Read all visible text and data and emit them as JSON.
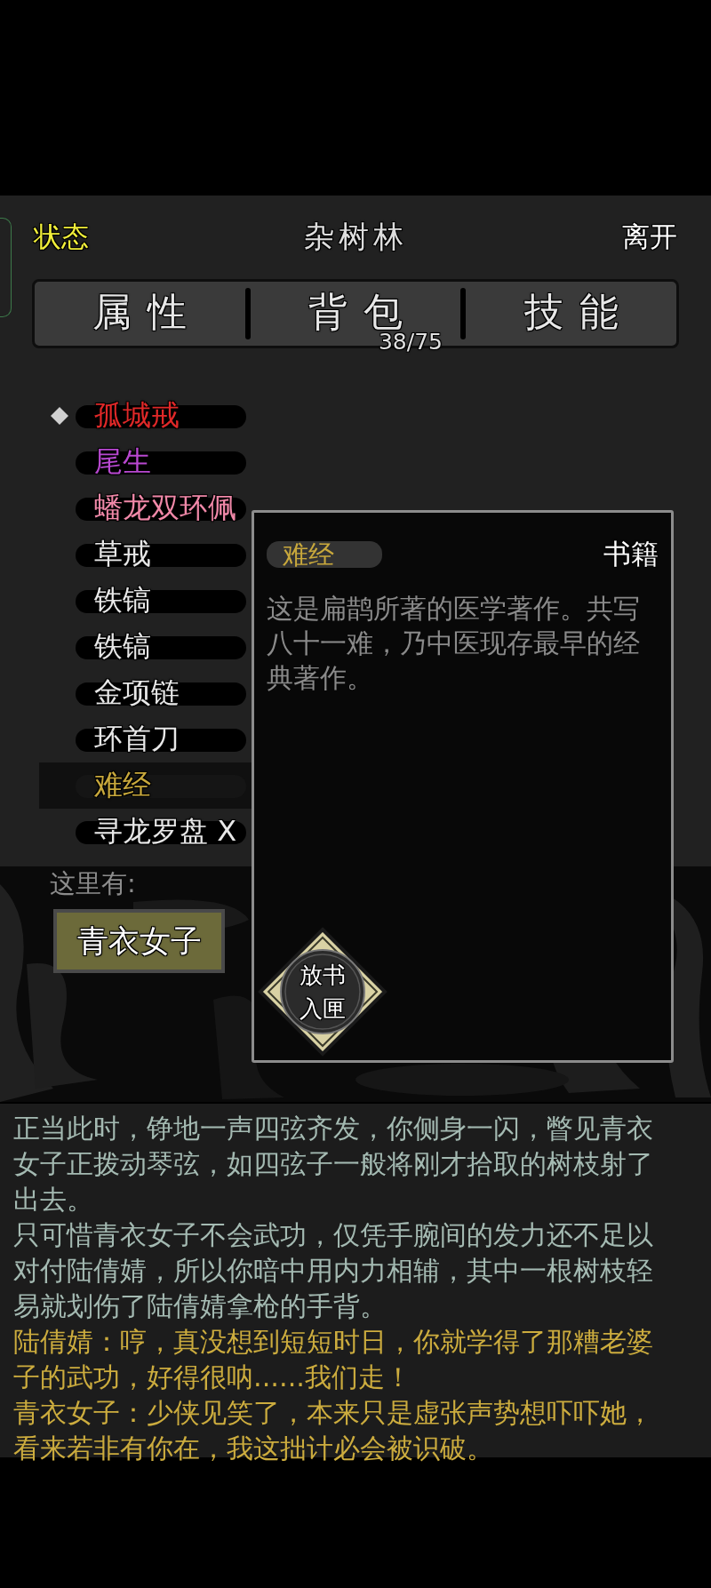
{
  "header": {
    "status_button": "状态",
    "location": "杂树林",
    "leave_button": "离开"
  },
  "tabs": [
    {
      "label": "属性"
    },
    {
      "label": "背包",
      "badge": "38/75"
    },
    {
      "label": "技能"
    }
  ],
  "inventory": {
    "items": [
      {
        "name": "孤城戒",
        "color": "#e02828",
        "selected": false,
        "marked": true
      },
      {
        "name": "尾生",
        "color": "#b848d0",
        "selected": false,
        "marked": false
      },
      {
        "name": "蟠龙双环佩",
        "color": "#f088a8",
        "selected": false,
        "marked": false
      },
      {
        "name": "草戒",
        "color": "#e8e8e8",
        "selected": false,
        "marked": false
      },
      {
        "name": "铁镐",
        "color": "#e8e8e8",
        "selected": false,
        "marked": false
      },
      {
        "name": "铁镐",
        "color": "#e8e8e8",
        "selected": false,
        "marked": false
      },
      {
        "name": "金项链",
        "color": "#e8e8e8",
        "selected": false,
        "marked": false
      },
      {
        "name": "环首刀",
        "color": "#e8e8e8",
        "selected": false,
        "marked": false
      },
      {
        "name": "难经",
        "color": "#c8a83c",
        "selected": true,
        "marked": false
      },
      {
        "name": "寻龙罗盘 X",
        "color": "#e8e8e8",
        "selected": false,
        "marked": false
      }
    ]
  },
  "detail": {
    "name": "难经",
    "category": "书籍",
    "description": "这是扁鹊所著的医学著作。共写八十一难，乃中医现存最早的经典著作。",
    "action": "放书入匣"
  },
  "scene": {
    "label": "这里有:",
    "npcs": [
      "青衣女子"
    ]
  },
  "log": [
    {
      "kind": "narration",
      "text": "正当此时，铮地一声四弦齐发，你侧身一闪，瞥见青衣女子正拨动琴弦，如四弦子一般将刚才拾取的树枝射了出去。"
    },
    {
      "kind": "narration",
      "text": "只可惜青衣女子不会武功，仅凭手腕间的发力还不足以对付陆倩婧，所以你暗中用内力相辅，其中一根树枝轻易就划伤了陆倩婧拿枪的手背。"
    },
    {
      "kind": "dialogue",
      "text": "陆倩婧：哼，真没想到短短时日，你就学得了那糟老婆子的武功，好得很呐......我们走！"
    },
    {
      "kind": "dialogue",
      "text": "青衣女子：少侠见笑了，本来只是虚张声势想吓吓她，看来若非有你在，我这拙计必会被识破。"
    }
  ]
}
